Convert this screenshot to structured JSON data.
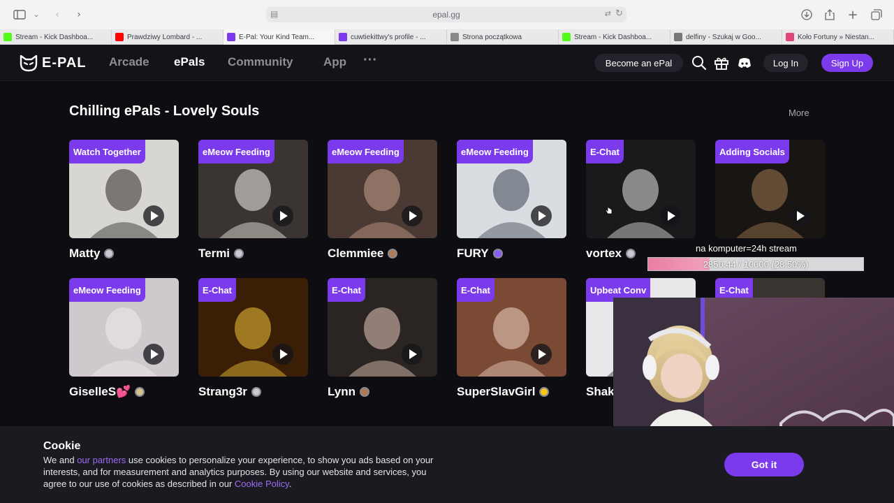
{
  "browser": {
    "url": "epal.gg",
    "tabs": [
      {
        "label": "Stream - Kick Dashboa...",
        "color": "#53fc18",
        "active": false
      },
      {
        "label": "Prawdziwy Lombard - ...",
        "color": "#ff0000",
        "active": false
      },
      {
        "label": "E-Pal: Your Kind Team...",
        "color": "#7c3aed",
        "active": true
      },
      {
        "label": "cuwtiekittwy's profile - ...",
        "color": "#7c3aed",
        "active": false
      },
      {
        "label": "Strona początkowa",
        "color": "#888888",
        "active": false
      },
      {
        "label": "Stream - Kick Dashboa...",
        "color": "#53fc18",
        "active": false
      },
      {
        "label": "delfiny - Szukaj w Goo...",
        "color": "#777777",
        "active": false
      },
      {
        "label": "Koło Fortuny » Niestan...",
        "color": "#e0457b",
        "active": false
      }
    ]
  },
  "header": {
    "logo": "E-PAL",
    "nav": [
      "Arcade",
      "ePals",
      "Community",
      "App"
    ],
    "more": "···",
    "become": "Become an ePal",
    "login": "Log In",
    "signup": "Sign Up"
  },
  "section": {
    "title": "Chilling ePals - Lovely Souls",
    "more": "More"
  },
  "cards": [
    {
      "tag": "Watch Together",
      "name": "Matty",
      "badge": "silver"
    },
    {
      "tag": "eMeow Feeding",
      "name": "Termi",
      "badge": "silver"
    },
    {
      "tag": "eMeow Feeding",
      "name": "Clemmiee",
      "badge": "bronze"
    },
    {
      "tag": "eMeow Feeding",
      "name": "FURY",
      "badge": "purple"
    },
    {
      "tag": "E-Chat",
      "name": "vortex",
      "badge": "silver"
    },
    {
      "tag": "Adding Socials",
      "name": "",
      "badge": ""
    },
    {
      "tag": "eMeow Feeding",
      "name": "GiselleS💕",
      "badge": "gold-silver"
    },
    {
      "tag": "E-Chat",
      "name": "Strang3r",
      "badge": "silver"
    },
    {
      "tag": "E-Chat",
      "name": "Lynn",
      "badge": "bronze"
    },
    {
      "tag": "E-Chat",
      "name": "SuperSlavGirl",
      "badge": "gold"
    },
    {
      "tag": "Upbeat Conv",
      "name": "Shak",
      "badge": ""
    },
    {
      "tag": "E-Chat",
      "name": "",
      "badge": ""
    }
  ],
  "overlay": {
    "goal_title": "na komputer=24h stream",
    "goal_progress": "2850.44 / 10000 (28.50%)",
    "goal_fraction": 0.285
  },
  "cookie": {
    "title": "Cookie",
    "text_a": "We and ",
    "link_partners": "our partners",
    "text_b": " use cookies to personalize your experience, to show you ads based on your interests, and for measurement and analytics purposes. By using our website and services, you agree to our use of cookies as described in our ",
    "link_policy": "Cookie Policy",
    "text_c": ".",
    "button": "Got it"
  }
}
